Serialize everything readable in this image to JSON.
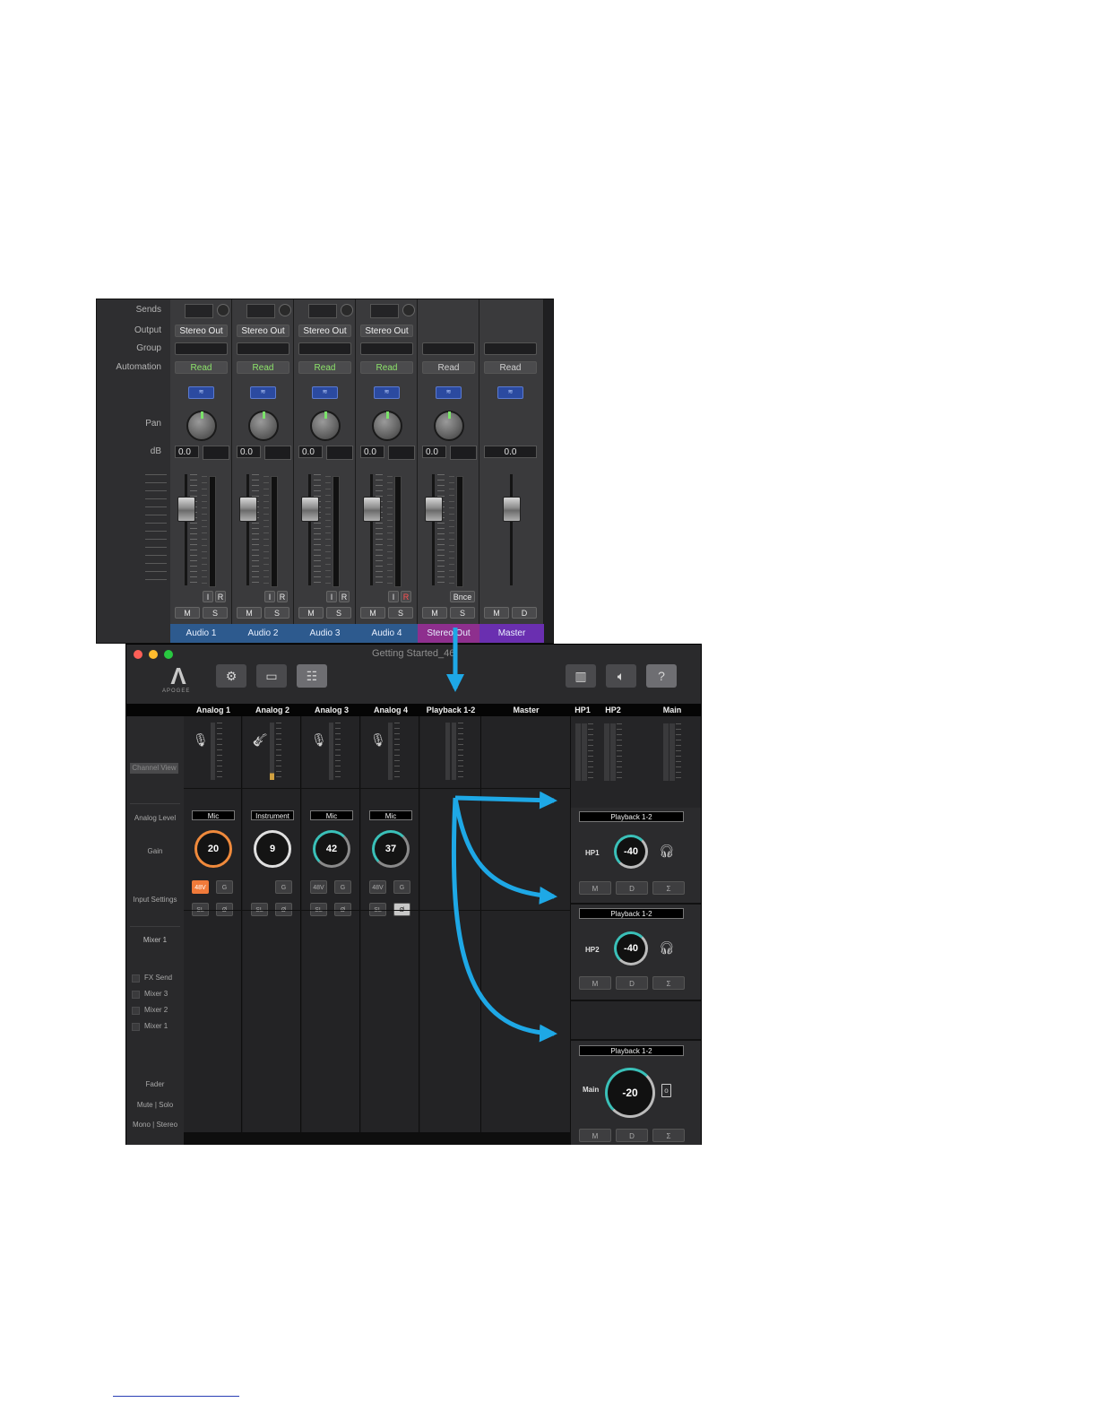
{
  "logic": {
    "labels": {
      "sends": "Sends",
      "output": "Output",
      "group": "Group",
      "automation": "Automation",
      "pan": "Pan",
      "db": "dB"
    },
    "strips": [
      {
        "name": "Audio 1",
        "output": "Stereo Out",
        "automation": "Read",
        "db": "0.0",
        "btn1": "I",
        "btn2": "R",
        "mute": "M",
        "solo": "S"
      },
      {
        "name": "Audio 2",
        "output": "Stereo Out",
        "automation": "Read",
        "db": "0.0",
        "btn1": "I",
        "btn2": "R",
        "mute": "M",
        "solo": "S"
      },
      {
        "name": "Audio 3",
        "output": "Stereo Out",
        "automation": "Read",
        "db": "0.0",
        "btn1": "I",
        "btn2": "R",
        "mute": "M",
        "solo": "S"
      },
      {
        "name": "Audio 4",
        "output": "Stereo Out",
        "automation": "Read",
        "db": "0.0",
        "btn1": "I",
        "btn2": "R",
        "mute": "M",
        "solo": "S"
      },
      {
        "name": "Stereo Out",
        "output": "",
        "automation": "Read",
        "db": "0.0",
        "bnce": "Bnce",
        "mute": "M",
        "solo": "S"
      },
      {
        "name": "Master",
        "output": "",
        "automation": "Read",
        "db": "0.0",
        "mute": "M",
        "solo": "D"
      }
    ],
    "colors": {
      "audio": "#2d5a8e",
      "stereo": "#8e2f8e",
      "master": "#6a2fb0",
      "read_active": "#8de36a"
    }
  },
  "apogee": {
    "window_title": "Getting Started_46",
    "logo_text": "APOGEE",
    "channels": [
      {
        "name": "Analog 1",
        "source": "Mic",
        "gain": "20",
        "b48": "48V",
        "g": "G",
        "sl": "SL",
        "phase": "Ø"
      },
      {
        "name": "Analog 2",
        "source": "Instrument",
        "gain": "9",
        "g": "G",
        "sl": "SL",
        "phase": "Ø"
      },
      {
        "name": "Analog 3",
        "source": "Mic",
        "gain": "42",
        "b48": "48V",
        "g": "G",
        "sl": "SL",
        "phase": "Ø"
      },
      {
        "name": "Analog 4",
        "source": "Mic",
        "gain": "37",
        "b48": "48V",
        "g": "G",
        "sl": "SL",
        "phase": "Ø"
      }
    ],
    "playback_name": "Playback 1-2",
    "master_name": "Master",
    "out_headers": {
      "hp1": "HP1",
      "hp2": "HP2",
      "main": "Main"
    },
    "sidebar": {
      "channel_view": "Channel View",
      "analog_level": "Analog Level",
      "gain": "Gain",
      "input_settings": "Input Settings",
      "mixer": "Mixer 1",
      "sends": [
        "FX Send",
        "Mixer 3",
        "Mixer 2",
        "Mixer 1"
      ],
      "fader": "Fader",
      "mute_solo": "Mute | Solo",
      "mono_stereo": "Mono | Stereo"
    },
    "outputs": [
      {
        "label": "HP1",
        "source": "Playback 1-2",
        "level": "-40",
        "m": "M",
        "d": "D",
        "sum": "Σ"
      },
      {
        "label": "HP2",
        "source": "Playback 1-2",
        "level": "-40",
        "m": "M",
        "d": "D",
        "sum": "Σ"
      },
      {
        "label": "Main",
        "source": "Playback 1-2",
        "level": "-20",
        "m": "M",
        "d": "D",
        "sum": "Σ"
      }
    ],
    "colors": {
      "accent": "#3ac0b8",
      "phantom": "#f07a3a",
      "arrow": "#1ea8e6"
    }
  }
}
